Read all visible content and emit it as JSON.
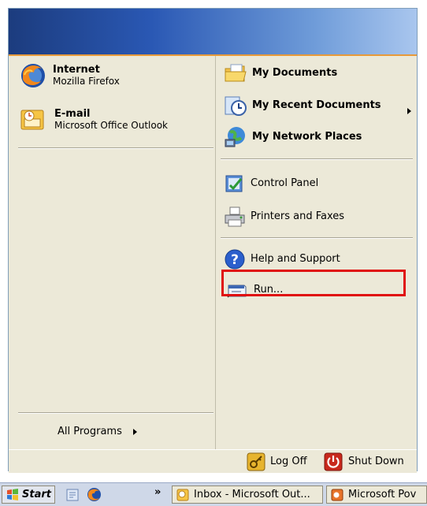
{
  "left_items": [
    {
      "title": "Internet",
      "subtitle": "Mozilla Firefox",
      "icon": "firefox-icon"
    },
    {
      "title": "E-mail",
      "subtitle": "Microsoft Office Outlook",
      "icon": "outlook-icon"
    }
  ],
  "all_programs": "All Programs",
  "right_items": [
    {
      "label": "My Documents",
      "icon": "folder-icon"
    },
    {
      "label": "My Recent Documents",
      "icon": "recent-documents-icon"
    },
    {
      "label": "My Network Places",
      "icon": "network-icon"
    },
    {
      "label": "Control Panel",
      "icon": "control-panel-icon"
    },
    {
      "label": "Printers and Faxes",
      "icon": "printer-icon"
    },
    {
      "label": "Help and Support",
      "icon": "help-icon"
    },
    {
      "label": "Run...",
      "icon": "run-icon"
    }
  ],
  "footer": {
    "logoff": "Log Off",
    "shutdown": "Shut Down"
  },
  "taskbar": {
    "start": "Start",
    "overflow": "»",
    "buttons": [
      "Inbox - Microsoft Out...",
      "Microsoft Pov"
    ]
  },
  "colors": {
    "highlight": "#e01010",
    "header_dark": "#1c3c7e",
    "header_light": "#a9c6ee"
  }
}
